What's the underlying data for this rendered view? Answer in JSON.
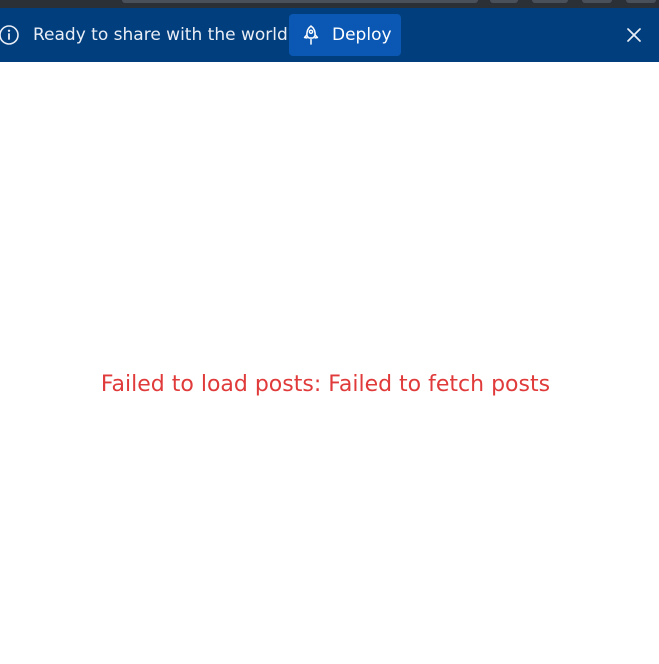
{
  "banner": {
    "message": "Ready to share with the world?",
    "deploy_label": "Deploy",
    "info_icon": "info-icon",
    "deploy_icon": "rocket-icon",
    "close_icon": "close-icon",
    "background_color": "#013e7d",
    "button_color": "#0a58b4"
  },
  "main": {
    "error_message": "Failed to load posts: Failed to fetch posts",
    "error_color": "#e03a3a"
  }
}
